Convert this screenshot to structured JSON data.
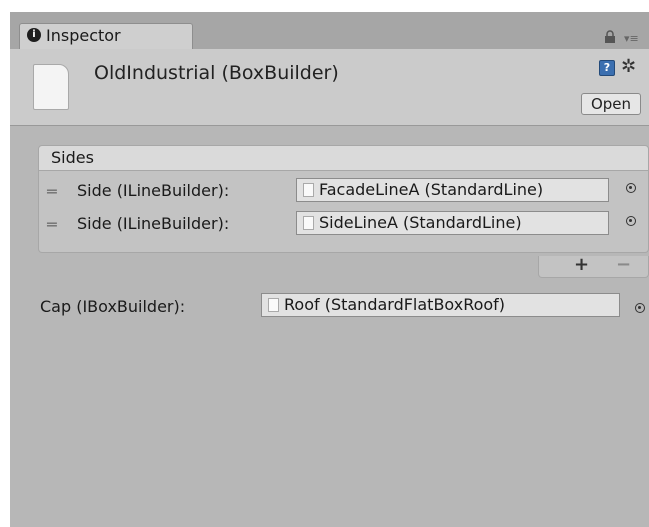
{
  "tab": {
    "icon": "info-icon",
    "label": "Inspector",
    "icon_glyph": "i"
  },
  "header": {
    "icon": "document-icon",
    "title": "OldIndustrial (BoxBuilder)",
    "help_icon": "help-book-icon",
    "help_glyph": "?",
    "settings_icon": "gear-icon",
    "open_label": "Open"
  },
  "sides": {
    "title": "Sides",
    "items": [
      {
        "label": "Side (ILineBuilder):",
        "value": "FacadeLineA (StandardLine)"
      },
      {
        "label": "Side (ILineBuilder):",
        "value": "SideLineA (StandardLine)"
      }
    ],
    "add_label": "+",
    "remove_label": "−"
  },
  "cap": {
    "label": "Cap (IBoxBuilder):",
    "value": "Roof (StandardFlatBoxRoof)"
  },
  "colors": {
    "window_bg": "#b7b7b7",
    "header_bg": "#cbcbcb",
    "field_bg": "#e2e2e2"
  }
}
